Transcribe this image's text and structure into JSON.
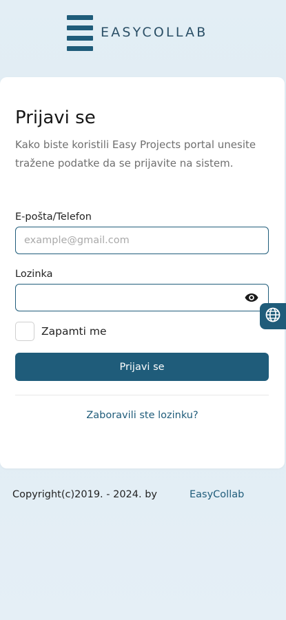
{
  "brand": {
    "name": "EASYCOLLAB",
    "logo_icon": "menu-bars-logo-icon",
    "color": "#1f5c7a"
  },
  "login": {
    "title": "Prijavi se",
    "description": "Kako biste koristili Easy Projects portal unesite tražene podatke da se prijavite na sistem.",
    "email_label": "E-pošta/Telefon",
    "email_value": "",
    "email_placeholder": "example@gmail.com",
    "password_label": "Lozinka",
    "password_value": "",
    "password_toggle_icon": "eye-icon",
    "remember_label": "Zapamti me",
    "remember_checked": false,
    "submit_label": "Prijavi se",
    "forgot_label": "Zaboravili ste lozinku?"
  },
  "language_switcher": {
    "icon": "globe-icon"
  },
  "footer": {
    "copyright": "Copyright(c)2019. - 2024. by",
    "brand_link": "EasyCollab"
  },
  "colors": {
    "primary": "#1f5c7a",
    "background": "#e3eef5",
    "card": "#ffffff"
  }
}
